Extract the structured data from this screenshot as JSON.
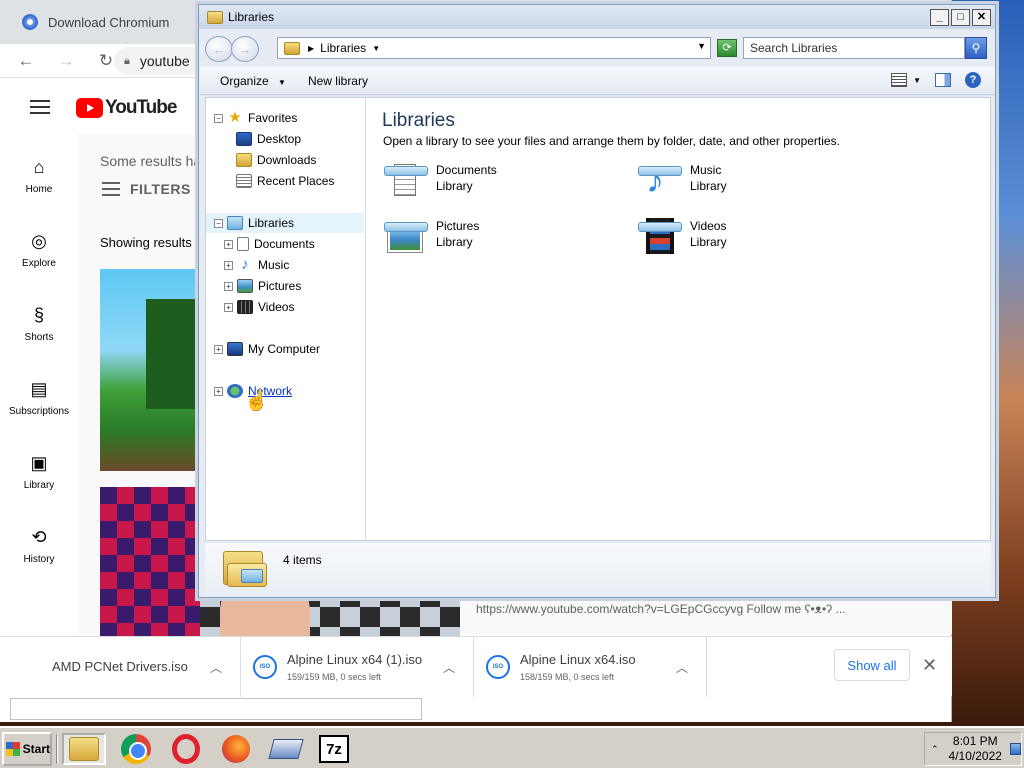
{
  "chrome": {
    "title": "Download Chromium",
    "url": "youtube",
    "nav": {
      "back": "←",
      "forward": "→",
      "reload": "↻"
    }
  },
  "youtube": {
    "logo": "YouTube",
    "sidebar": [
      {
        "label": "Home",
        "icon": "⌂"
      },
      {
        "label": "Explore",
        "icon": "◎"
      },
      {
        "label": "Shorts",
        "icon": "§"
      },
      {
        "label": "Subscriptions",
        "icon": "▤"
      },
      {
        "label": "Library",
        "icon": "▣"
      },
      {
        "label": "History",
        "icon": "⟲"
      }
    ],
    "results_note": "Some results ha",
    "filters": "FILTERS",
    "showing": "Showing results f",
    "desc": "https://www.youtube.com/watch?v=LGEpCGccyvg Follow me ʕ•ᴥ•ʔ ..."
  },
  "downloads": {
    "items": [
      {
        "name": "AMD PCNet Drivers.iso",
        "status": ""
      },
      {
        "name": "Alpine Linux x64 (1).iso",
        "status": "159/159 MB, 0 secs left"
      },
      {
        "name": "Alpine Linux x64.iso",
        "status": "158/159 MB, 0 secs left"
      }
    ],
    "show_all": "Show all",
    "close": "✕"
  },
  "explorer": {
    "title": "Libraries",
    "address": "Libraries",
    "search_placeholder": "Search Libraries",
    "commands": {
      "organize": "Organize",
      "new_library": "New library"
    },
    "tree": {
      "favorites": "Favorites",
      "desktop": "Desktop",
      "downloads": "Downloads",
      "recent": "Recent Places",
      "libraries": "Libraries",
      "documents": "Documents",
      "music": "Music",
      "pictures": "Pictures",
      "videos": "Videos",
      "computer": "My Computer",
      "network": "Network"
    },
    "heading": "Libraries",
    "subheading": "Open a library to see your files and arrange them by folder, date, and other properties.",
    "libraries": [
      {
        "name": "Documents",
        "type": "Library"
      },
      {
        "name": "Music",
        "type": "Library"
      },
      {
        "name": "Pictures",
        "type": "Library"
      },
      {
        "name": "Videos",
        "type": "Library"
      }
    ],
    "item_count": "4 items"
  },
  "taskbar": {
    "start": "Start",
    "time": "8:01 PM",
    "date": "4/10/2022",
    "seven_zip": "7z"
  }
}
